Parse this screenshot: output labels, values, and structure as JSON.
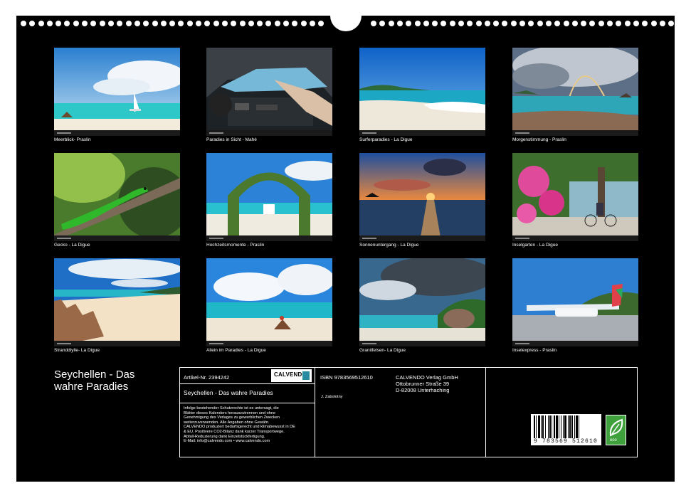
{
  "photos": [
    {
      "caption": "Meerblick- Praslin"
    },
    {
      "caption": "Paradies in Sicht - Mahé"
    },
    {
      "caption": "Surferparadies - La Digue"
    },
    {
      "caption": "Morgenstimmung - Praslin"
    },
    {
      "caption": "Gecko - La Digue"
    },
    {
      "caption": "Hochzeitsmomente - Praslin"
    },
    {
      "caption": "Sonnenuntergang - La Digue"
    },
    {
      "caption": "Inselgarten - La Digue"
    },
    {
      "caption": "Stranddiylle- La Digue"
    },
    {
      "caption": "Allein im Paradies - La Digue"
    },
    {
      "caption": "Granitfelsen- La Digue"
    },
    {
      "caption": "Inselexpress - Praslin"
    }
  ],
  "title": {
    "line1": "Seychellen - Das",
    "line2": "wahre Paradies"
  },
  "info": {
    "article": "Artikel-Nr. 2394242",
    "logo": "CALVENDO",
    "subtitle": "Seychellen - Das wahre Paradies",
    "isbn": "ISBN 9783569512610",
    "author": "J. Zabolotny",
    "publisher": [
      "CALVENDO Verlag GmbH",
      "Ottobrunner Straße 39",
      "D-82008 Unterhaching"
    ],
    "legal": [
      "Infolge bestehender Schutzrechte ist es untersagt, die",
      "Blätter dieses Kalenders herauszutrennen und ohne",
      "Genehmigung des Verlages zu gewerblichen Zwecken",
      "weiterzuverwenden. Alle Angaben ohne Gewähr.",
      "CALVENDO produziert bedarfsgerecht und klimabewusst in DE",
      "& EU. Positivere CO2-Bilanz dank kurzer Transportwege.",
      "Abfall-Reduzierung dank Einzelstückfertigung.",
      "E-Mail: info@calvendo.com • www.calvendo.com"
    ],
    "barcode_number": "9 783569 512610",
    "eco_label": "eco"
  }
}
